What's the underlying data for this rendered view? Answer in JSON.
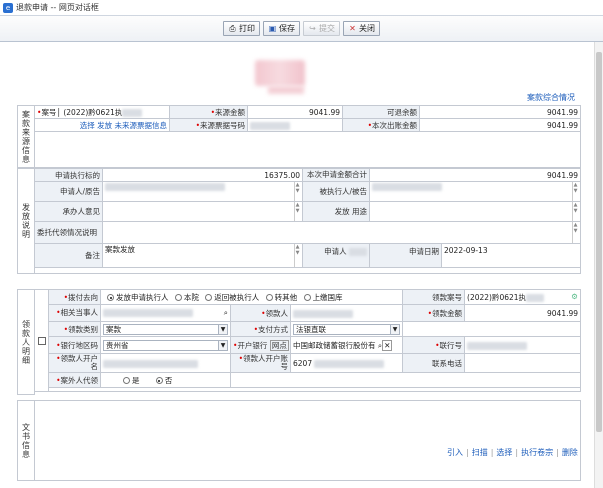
{
  "window": {
    "title": "退款申请 -- 网页对话框"
  },
  "toolbar": {
    "print": "打印",
    "save": "保存",
    "submit": "提交",
    "close": "关闭"
  },
  "header": {
    "case_link": "案款综合情况"
  },
  "source": {
    "section": "案款来源信息",
    "case_no_label": "案号",
    "case_no_value": "(2022)黔0621执",
    "amount_label": "来源金额",
    "amount_value": "9041.99",
    "refundable_label": "可退余额",
    "refundable_value": "9041.99",
    "select_link": "选择",
    "disburse_link": "发放",
    "unsource_link": "未来源票据信息",
    "ticket_label": "来源票据号码",
    "out_label": "本次出账金额",
    "out_value": "9041.99"
  },
  "grant": {
    "section": "发放说明",
    "exec_label": "申请执行标的",
    "exec_value": "16375.00",
    "total_label": "本次申请金额合计",
    "total_value": "9041.99",
    "applicant_label": "申请人/原告",
    "defendant_label": "被执行人/被告",
    "handler_label": "承办人意见",
    "purpose_label": "发放 用途",
    "entrust_label": "委托代领情况说明",
    "remark_label": "备注",
    "remark_value": "案款发放",
    "appl_label": "申请人",
    "date_label": "申请日期",
    "date_value": "2022-09-13"
  },
  "payee": {
    "section": "领款人明细",
    "direction_label": "拨付去向",
    "options": [
      "发放申请执行人",
      "本院",
      "返回被执行人",
      "转其他",
      "上缴国库"
    ],
    "selected": 0,
    "pay_case_label": "领款案号",
    "pay_case_value": "(2022)黔0621执",
    "party_label": "相关当事人",
    "payee_label": "领款人",
    "amount_label": "领款金额",
    "amount_value": "9041.99",
    "type_label": "领款类别",
    "type_value": "案款",
    "method_label": "支付方式",
    "method_value": "法银直联",
    "region_label": "银行地区码",
    "region_value": "贵州省",
    "bank_label": "开户银行",
    "bank_hint": "网点",
    "bank_value": "中国邮政储蓄银行股份有",
    "union_label": "联行号",
    "holder_label": "领款人开户名",
    "account_label": "领款人开户账号",
    "account_value": "6207",
    "phone_label": "联系电话",
    "outside_label": "案外人代领",
    "yes": "是",
    "no": "否"
  },
  "doc": {
    "section": "文书信息",
    "links": [
      "引入",
      "扫描",
      "选择",
      "执行卷宗",
      "删除"
    ]
  }
}
